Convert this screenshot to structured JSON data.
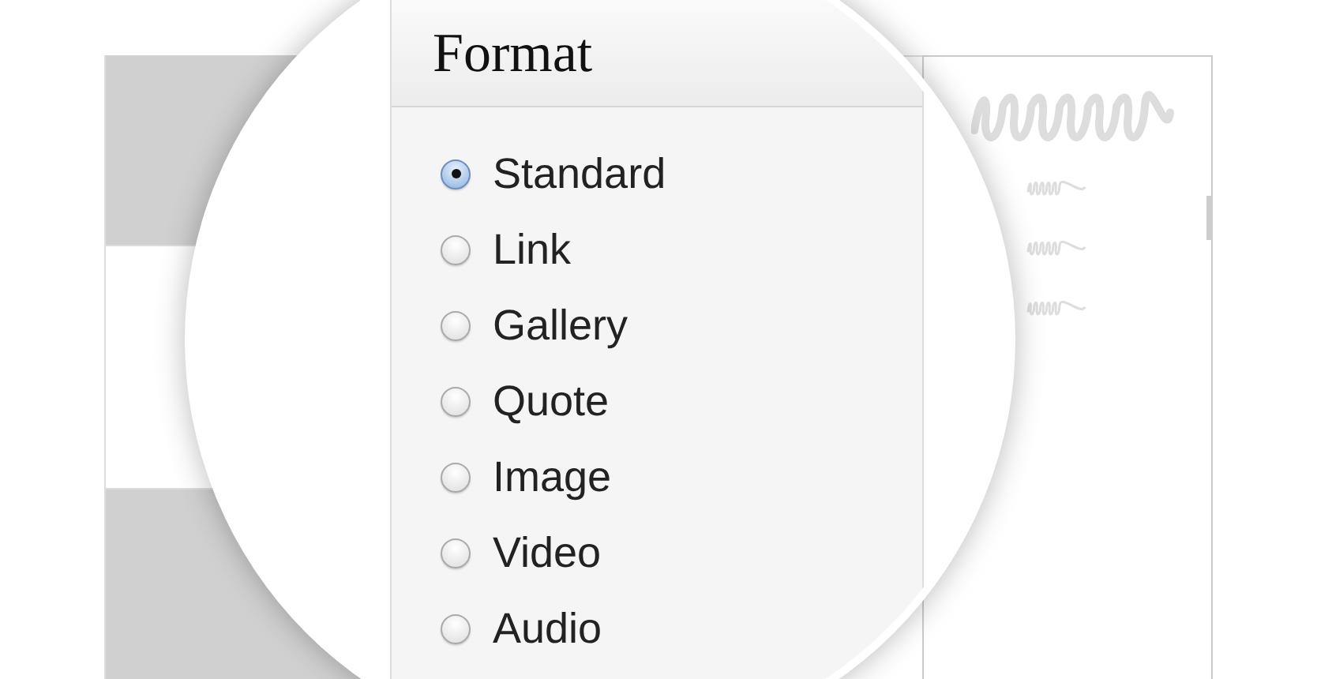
{
  "panel": {
    "title": "Format"
  },
  "formats": [
    {
      "label": "Standard",
      "selected": true
    },
    {
      "label": "Link",
      "selected": false
    },
    {
      "label": "Gallery",
      "selected": false
    },
    {
      "label": "Quote",
      "selected": false
    },
    {
      "label": "Image",
      "selected": false
    },
    {
      "label": "Video",
      "selected": false
    },
    {
      "label": "Audio",
      "selected": false
    }
  ]
}
